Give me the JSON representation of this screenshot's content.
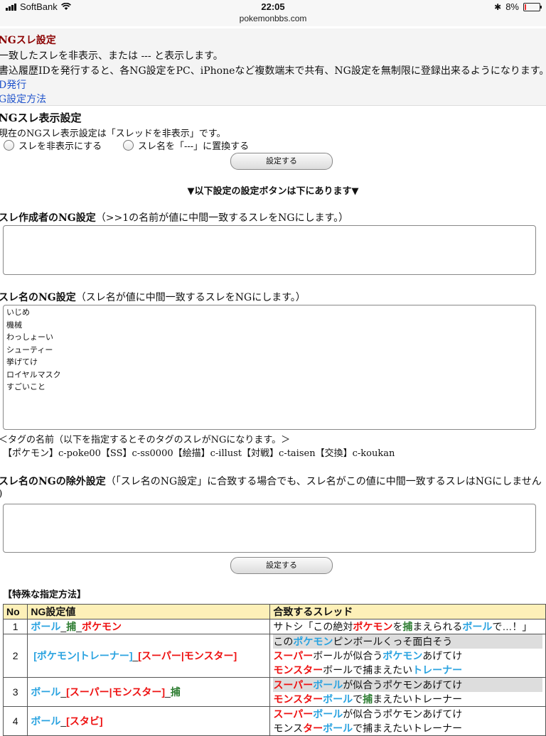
{
  "status": {
    "carrier": "SoftBank",
    "time": "22:05",
    "url": "pokemonbbs.com",
    "battery": "8%"
  },
  "info": {
    "title": "NGスレ設定",
    "line1": "一致したスレを非表示、または --- と表示します。",
    "line2": "書込履歴IDを発行すると、各NG設定をPC、iPhoneなど複数端末で共有、NG設定を無制限に登録出来るようになります。→",
    "link1": "D発行",
    "link2": "G設定方法"
  },
  "display": {
    "title": "NGスレ表示設定",
    "current": "現在のNGスレ表示設定は「スレッドを非表示」です。",
    "option1": "スレを非表示にする",
    "option2": "スレ名を「---」に置換する",
    "set_button": "設定する"
  },
  "notice": "▼以下設定の設定ボタンは下にあります▼",
  "author": {
    "title": "スレ作成者のNG設定",
    "desc": "（>>1の名前が値に中間一致するスレをNGにします。）",
    "value": ""
  },
  "name_ng": {
    "title": "スレ名のNG設定",
    "desc": "（スレ名が値に中間一致するスレをNGにします。）",
    "entries": [
      "いじめ",
      "機械",
      "わっしょーい",
      "シューティー",
      "挙げてけ",
      "ロイヤルマスク",
      "すごいこと"
    ]
  },
  "tags": {
    "heading": "＜タグの名前（以下を指定するとそのタグのスレがNGになります。＞",
    "list": "【ポケモン】c-poke00【SS】c-ss0000【絵描】c-illust【対戦】c-taisen【交換】c-koukan"
  },
  "exclude": {
    "title": "スレ名のNGの除外設定",
    "desc": "（「スレ名のNG設定」に合致する場合でも、スレ名がこの値に中間一致するスレはNGにしません",
    "desc2": ")",
    "value": "",
    "set_button": "設定する"
  },
  "special": {
    "heading": "【特殊な指定方法】",
    "columns": [
      "No",
      "NG設定値",
      "合致するスレッド"
    ],
    "rows": [
      {
        "no": "1"
      },
      {
        "no": "2"
      },
      {
        "no": "3"
      },
      {
        "no": "4"
      }
    ]
  },
  "colors": {
    "blue_keyword": "#2aa3e0",
    "red_keyword": "#ee1111",
    "green_keyword": "#2e7d32",
    "header_bg": "#fdf0b8",
    "title_red": "#8b0000",
    "link_blue": "#2255cc"
  }
}
